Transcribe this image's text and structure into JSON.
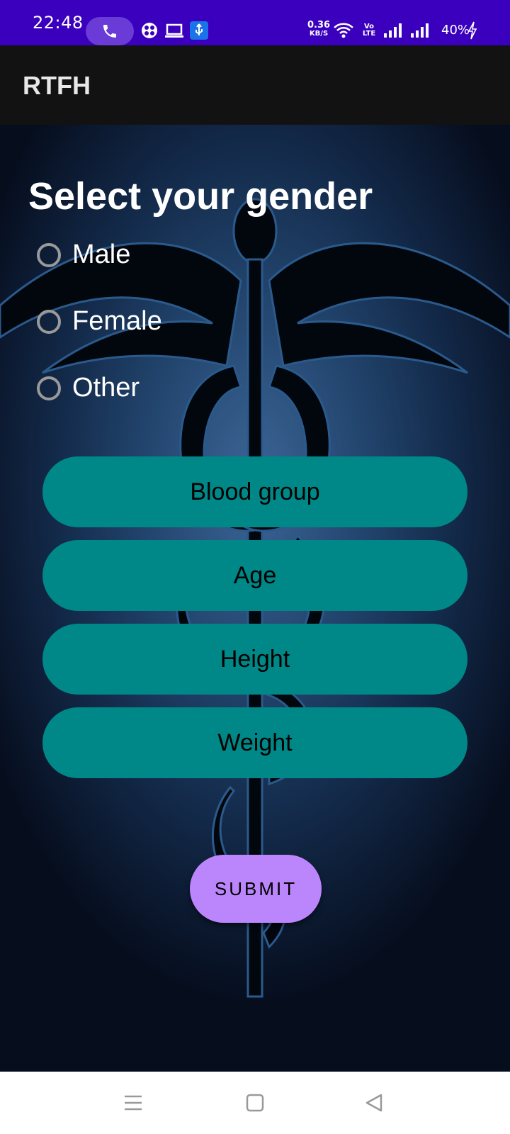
{
  "status_bar": {
    "time": "22:48",
    "net_speed_value": "0.36",
    "net_speed_unit": "KB/S",
    "volte_label": "Vo LTE",
    "battery": "40%",
    "bg_color": "#3a00bd",
    "icons": [
      "phone-call-icon",
      "usb-icon",
      "laptop-icon",
      "usb-debug-icon",
      "wifi-icon",
      "volte-icon",
      "signal-icon",
      "signal-icon",
      "battery-charging-icon"
    ]
  },
  "app_bar": {
    "title": "RTFH"
  },
  "form": {
    "title": "Select your gender",
    "gender_options": [
      {
        "label": "Male",
        "selected": false
      },
      {
        "label": "Female",
        "selected": false
      },
      {
        "label": "Other",
        "selected": false
      }
    ],
    "buttons": {
      "blood_group": "Blood group",
      "age": "Age",
      "height": "Height",
      "weight": "Weight"
    },
    "submit_label": "SUBMIT"
  },
  "colors": {
    "pill_button": "#008787",
    "submit_button": "#bb86fc",
    "app_bar": "#121212"
  },
  "nav_bar": {
    "icons": [
      "menu-icon",
      "home-icon",
      "back-icon"
    ]
  }
}
